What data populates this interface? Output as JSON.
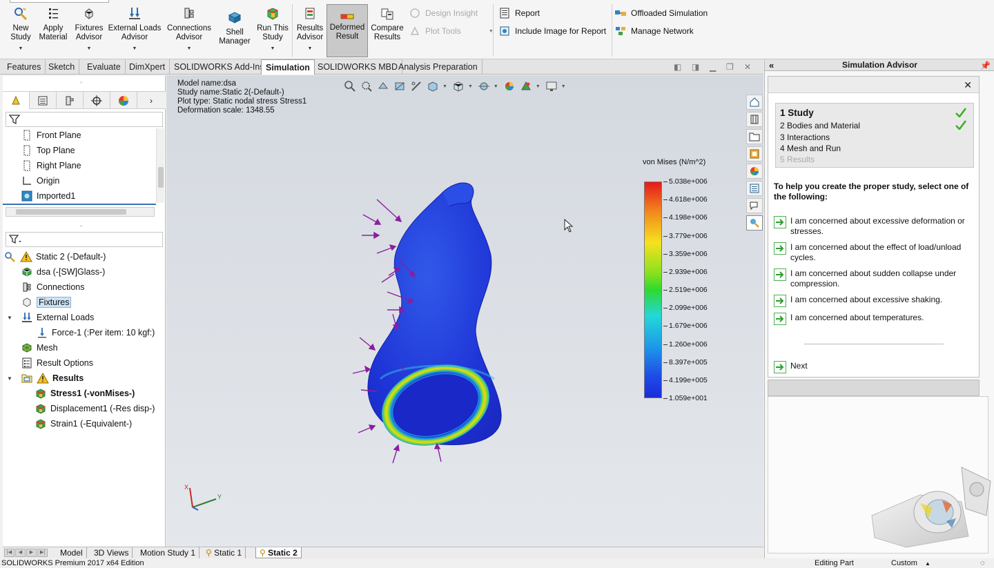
{
  "ribbon": {
    "new_study": "New Study",
    "apply_material": "Apply Material",
    "fixtures_advisor": "Fixtures Advisor",
    "external_loads_advisor": "External Loads Advisor",
    "connections_advisor": "Connections Advisor",
    "shell_manager": "Shell Manager",
    "run_this_study": "Run This Study",
    "results_advisor": "Results Advisor",
    "deformed_result": "Deformed Result",
    "compare_results": "Compare Results",
    "design_insight": "Design Insight",
    "plot_tools": "Plot Tools",
    "report": "Report",
    "include_image_for_report": "Include Image for Report",
    "offloaded_simulation": "Offloaded Simulation",
    "manage_network": "Manage Network"
  },
  "command_tabs": [
    "Features",
    "Sketch",
    "Evaluate",
    "DimXpert",
    "SOLIDWORKS Add-Ins",
    "Simulation",
    "SOLIDWORKS MBD",
    "Analysis Preparation"
  ],
  "active_command_tab": "Simulation",
  "feature_tree": [
    "Front Plane",
    "Top Plane",
    "Right Plane",
    "Origin",
    "Imported1"
  ],
  "study_tree": {
    "study": "Static 2 (-Default-)",
    "part": "dsa (-[SW]Glass-)",
    "connections": "Connections",
    "fixtures": "Fixtures",
    "external_loads": "External Loads",
    "force": "Force-1 (:Per item: 10 kgf:)",
    "mesh": "Mesh",
    "result_options": "Result Options",
    "results": "Results",
    "stress": "Stress1 (-vonMises-)",
    "displacement": "Displacement1 (-Res disp-)",
    "strain": "Strain1 (-Equivalent-)"
  },
  "model_info": {
    "model_name": "Model name:dsa",
    "study_name": "Study name:Static 2(-Default-)",
    "plot_type": "Plot type: Static nodal stress Stress1",
    "deformation_scale": "Deformation scale: 1348.55"
  },
  "legend": {
    "title": "von Mises (N/m^2)",
    "labels": [
      "5.038e+006",
      "4.618e+006",
      "4.198e+006",
      "3.779e+006",
      "3.359e+006",
      "2.939e+006",
      "2.519e+006",
      "2.099e+006",
      "1.679e+006",
      "1.260e+006",
      "8.397e+005",
      "4.199e+005",
      "1.059e+001"
    ],
    "colors": {
      "max": "#e41b1b",
      "mid": "#2fd92f",
      "min": "#1a2cdb"
    }
  },
  "bottom_tabs": [
    "Model",
    "3D Views",
    "Motion Study 1",
    "Static 1",
    "Static 2"
  ],
  "active_bottom_tab": "Static 2",
  "status": {
    "edition": "SOLIDWORKS Premium 2017 x64 Edition",
    "mode": "Editing Part",
    "units": "Custom"
  },
  "advisor": {
    "panel_title": "Simulation Advisor",
    "steps": [
      {
        "num": "1",
        "label": "Study"
      },
      {
        "num": "2",
        "label": "Bodies and Material"
      },
      {
        "num": "3",
        "label": "Interactions"
      },
      {
        "num": "4",
        "label": "Mesh and Run"
      },
      {
        "num": "5",
        "label": "Results"
      }
    ],
    "prompt": "To help you create the proper study, select one of the following:",
    "options": [
      "I am concerned about excessive deformation or stresses.",
      "I am concerned about the effect of load/unload cycles.",
      "I am concerned about sudden collapse under compression.",
      "I am concerned about excessive shaking.",
      "I am concerned about temperatures."
    ],
    "next": "Next"
  },
  "triad": {
    "x": "X",
    "y": "Y"
  }
}
